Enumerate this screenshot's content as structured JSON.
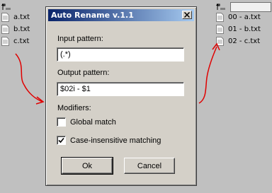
{
  "left_panel": {
    "files": [
      {
        "name": "a.txt"
      },
      {
        "name": "b.txt"
      },
      {
        "name": "c.txt"
      }
    ]
  },
  "right_panel": {
    "files": [
      {
        "name": "00 - a.txt"
      },
      {
        "name": "01 - b.txt"
      },
      {
        "name": "02 - c.txt"
      }
    ]
  },
  "dialog": {
    "title": "Auto Rename v.1.1",
    "input_label": "Input pattern:",
    "input_value": "(.*)",
    "output_label": "Output pattern:",
    "output_value": "$02i - $1",
    "modifiers_label": "Modifiers:",
    "global_match": {
      "label": "Global match",
      "checked": false
    },
    "case_insensitive": {
      "label": "Case-insensitive matching",
      "checked": true
    },
    "ok_label": "Ok",
    "cancel_label": "Cancel"
  },
  "colors": {
    "background": "#c0c0c0",
    "dialog_face": "#d4d0c8",
    "title_start": "#0a246a",
    "title_end": "#a6caf0",
    "arrow": "#e00000"
  },
  "icons": {
    "up": "folder-up-icon",
    "file": "text-file-icon",
    "close": "close-icon",
    "check": "checkmark-icon"
  }
}
